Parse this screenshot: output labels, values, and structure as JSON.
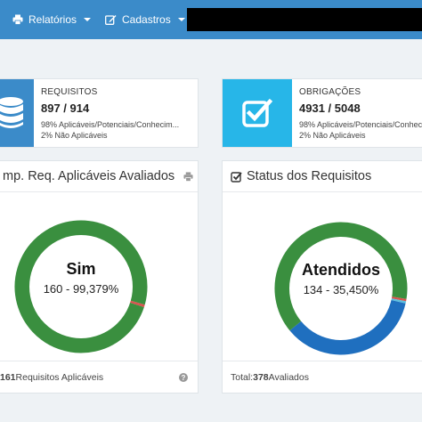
{
  "navbar": {
    "items": [
      {
        "label": "Relatórios",
        "icon": "print-icon"
      },
      {
        "label": "Cadastros",
        "icon": "edit-icon"
      }
    ],
    "background": "#3b8bc9"
  },
  "stats": [
    {
      "label": "REQUISITOS",
      "value": "897 / 914",
      "line1": "98% Aplicáveis/Potenciais/Conhecim...",
      "line2": "2% Não Aplicáveis",
      "icon": "database-icon",
      "icon_bg": "#3b8bc9"
    },
    {
      "label": "OBRIGAÇÕES",
      "value": "4931 / 5048",
      "line1": "98% Aplicáveis/Potenciais/Conhecim...",
      "line2": "2% Não Aplicáveis",
      "icon": "checkbox-icon",
      "icon_bg": "#27b6e8"
    }
  ],
  "panels": [
    {
      "title": "mp. Req. Aplicáveis Avaliados",
      "header_icon": "print-icon",
      "donut_label": "Sim",
      "donut_value": "160 - 99,379%",
      "footer_count": "161",
      "footer_text": " Requisitos Aplicáveis",
      "footer_icon": "help-icon"
    },
    {
      "title": "Status dos Requisitos",
      "header_icon": "checkbox-small-icon",
      "donut_label": "Atendidos",
      "donut_value": "134 - 35,450%",
      "footer_prefix": "Total: ",
      "footer_count": "378",
      "footer_text": " Avaliados"
    }
  ],
  "chart_data": [
    {
      "type": "pie",
      "title": "",
      "segments": [
        {
          "label": "Sim",
          "value": 160,
          "color": "#3a8f3f"
        },
        {
          "value": 1,
          "color": "#d9534f"
        }
      ]
    },
    {
      "type": "pie",
      "title": "",
      "segments": [
        {
          "label": "Atendidos",
          "value": 134,
          "color": "#1f6fbf"
        },
        {
          "value": 240,
          "color": "#3a8f3f"
        },
        {
          "value": 2,
          "color": "#d9534f"
        },
        {
          "value": 2,
          "color": "#5bc0de"
        }
      ]
    }
  ]
}
